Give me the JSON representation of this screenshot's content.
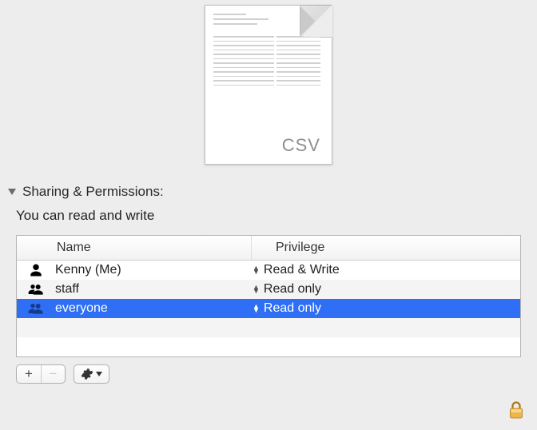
{
  "preview": {
    "badge": "CSV"
  },
  "section": {
    "title": "Sharing & Permissions:",
    "status": "You can read and write"
  },
  "table": {
    "columns": {
      "name": "Name",
      "priv": "Privilege"
    },
    "rows": [
      {
        "name": "Kenny (Me)",
        "priv": "Read & Write",
        "icon": "person",
        "selected": false
      },
      {
        "name": "staff",
        "priv": "Read only",
        "icon": "group",
        "selected": false
      },
      {
        "name": "everyone",
        "priv": "Read only",
        "icon": "group",
        "selected": true
      }
    ]
  },
  "toolbar": {
    "add": "+",
    "remove": "−"
  }
}
